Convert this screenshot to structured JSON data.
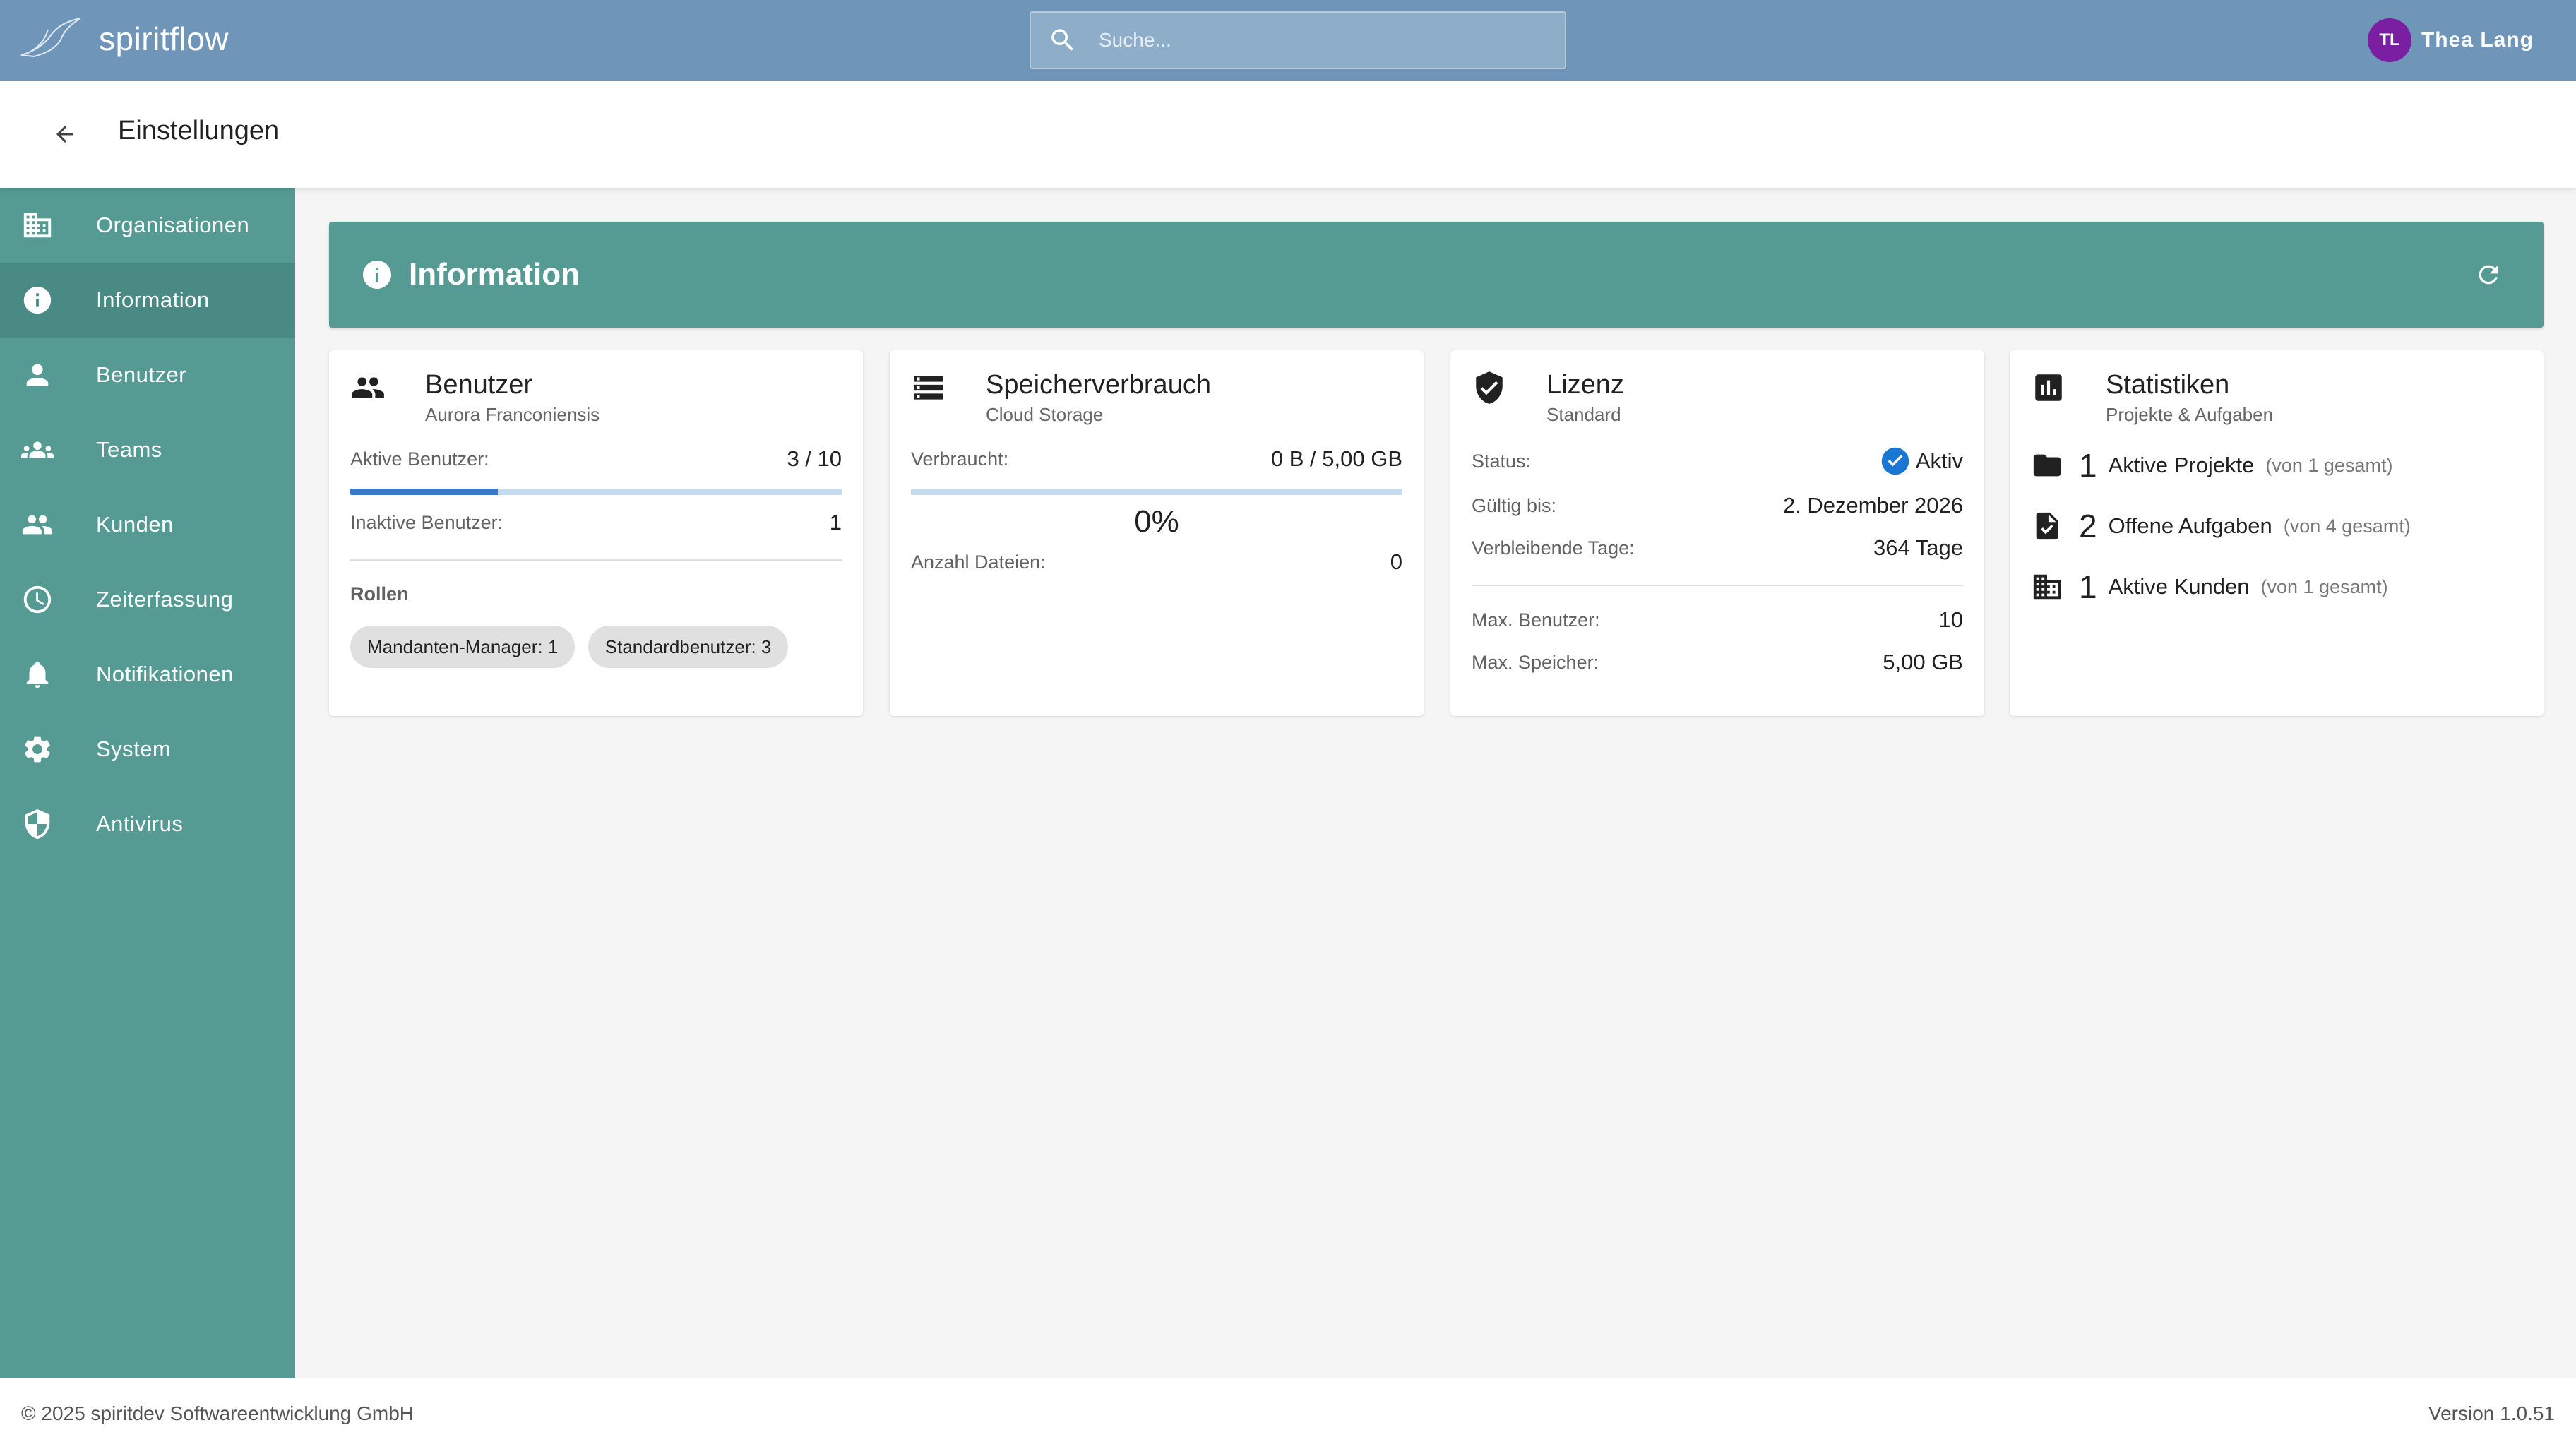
{
  "app": {
    "name": "spiritflow"
  },
  "search": {
    "placeholder": "Suche..."
  },
  "user": {
    "initials": "TL",
    "name": "Thea Lang"
  },
  "page": {
    "title": "Einstellungen"
  },
  "sidebar": {
    "items": [
      {
        "label": "Organisationen",
        "icon": "building-icon"
      },
      {
        "label": "Information",
        "icon": "info-icon",
        "active": true
      },
      {
        "label": "Benutzer",
        "icon": "person-icon"
      },
      {
        "label": "Teams",
        "icon": "groups-icon"
      },
      {
        "label": "Kunden",
        "icon": "people-icon"
      },
      {
        "label": "Zeiterfassung",
        "icon": "clock-icon"
      },
      {
        "label": "Notifikationen",
        "icon": "bell-icon"
      },
      {
        "label": "System",
        "icon": "gear-icon"
      },
      {
        "label": "Antivirus",
        "icon": "shield-icon"
      }
    ]
  },
  "section": {
    "title": "Information"
  },
  "cards": {
    "users": {
      "title": "Benutzer",
      "subtitle": "Aurora Franconiensis",
      "active_label": "Aktive Benutzer:",
      "active_value": "3 / 10",
      "active_fraction": 0.3,
      "inactive_label": "Inaktive Benutzer:",
      "inactive_value": "1",
      "roles_label": "Rollen",
      "roles": [
        "Mandanten-Manager: 1",
        "Standardbenutzer: 3"
      ]
    },
    "storage": {
      "title": "Speicherverbrauch",
      "subtitle": "Cloud Storage",
      "used_label": "Verbraucht:",
      "used_value": "0 B / 5,00 GB",
      "used_fraction": 0,
      "percent": "0%",
      "files_label": "Anzahl Dateien:",
      "files_value": "0"
    },
    "license": {
      "title": "Lizenz",
      "subtitle": "Standard",
      "status_label": "Status:",
      "status_value": "Aktiv",
      "valid_label": "Gültig bis:",
      "valid_value": "2. Dezember 2026",
      "remaining_label": "Verbleibende Tage:",
      "remaining_value": "364 Tage",
      "max_users_label": "Max. Benutzer:",
      "max_users_value": "10",
      "max_storage_label": "Max. Speicher:",
      "max_storage_value": "5,00 GB"
    },
    "stats": {
      "title": "Statistiken",
      "subtitle": "Projekte & Aufgaben",
      "items": [
        {
          "num": "1",
          "label": "Aktive Projekte",
          "total": "(von 1 gesamt)",
          "icon": "folder-icon"
        },
        {
          "num": "2",
          "label": "Offene Aufgaben",
          "total": "(von 4 gesamt)",
          "icon": "task-icon"
        },
        {
          "num": "1",
          "label": "Aktive Kunden",
          "total": "(von 1 gesamt)",
          "icon": "building-icon"
        }
      ]
    }
  },
  "footer": {
    "copyright": "© 2025 spiritdev Softwareentwicklung GmbH",
    "version": "Version 1.0.51"
  },
  "colors": {
    "topbar": "#6f96b8",
    "sidebar": "#559b94",
    "sidebar_active": "#4a8a84",
    "avatar": "#7b1fa2",
    "progress": "#3a77c9",
    "status_ok": "#1976d2"
  }
}
